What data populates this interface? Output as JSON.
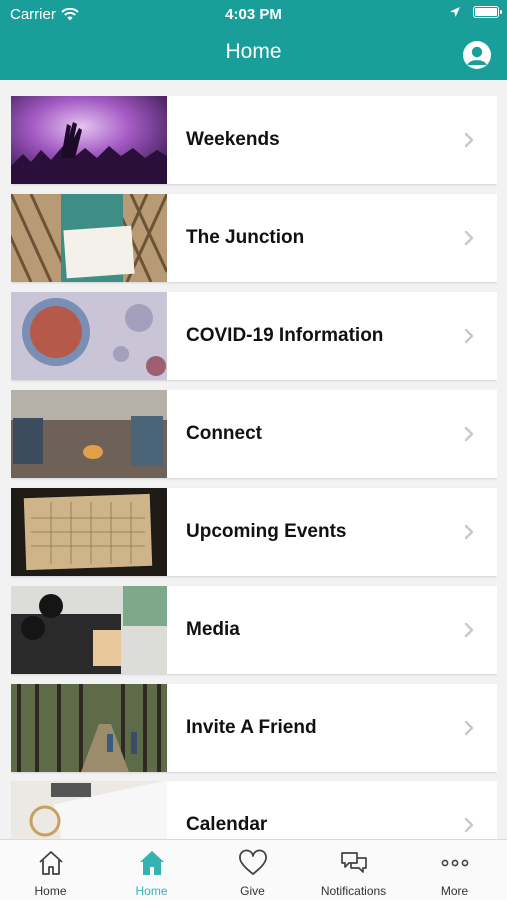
{
  "status_bar": {
    "carrier": "Carrier",
    "time": "4:03 PM"
  },
  "header": {
    "title": "Home"
  },
  "items": [
    {
      "label": "Weekends",
      "icon": "chevron-right-icon"
    },
    {
      "label": "The Junction",
      "icon": "chevron-right-icon"
    },
    {
      "label": "COVID-19 Information",
      "icon": "chevron-right-icon"
    },
    {
      "label": "Connect",
      "icon": "chevron-right-icon"
    },
    {
      "label": "Upcoming Events",
      "icon": "chevron-right-icon"
    },
    {
      "label": "Media",
      "icon": "chevron-right-icon"
    },
    {
      "label": "Invite A Friend",
      "icon": "chevron-right-icon"
    },
    {
      "label": "Calendar",
      "icon": "chevron-right-icon"
    }
  ],
  "tabs": [
    {
      "label": "Home",
      "icon": "home-outline-icon",
      "active": false
    },
    {
      "label": "Home",
      "icon": "home-filled-icon",
      "active": true
    },
    {
      "label": "Give",
      "icon": "heart-icon",
      "active": false
    },
    {
      "label": "Notifications",
      "icon": "chat-bubbles-icon",
      "active": false
    },
    {
      "label": "More",
      "icon": "more-dots-icon",
      "active": false
    }
  ],
  "colors": {
    "header": "#1a9e9a",
    "active_tab": "#36b3b0"
  }
}
